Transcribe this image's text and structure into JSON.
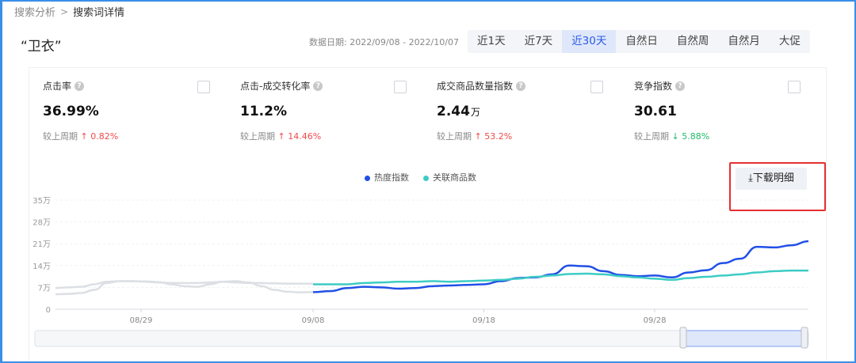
{
  "breadcrumb": {
    "parent": "搜索分析",
    "separator": ">",
    "current": "搜索词详情"
  },
  "title": "“卫衣”",
  "date_range": "数据日期: 2022/09/08 - 2022/10/07",
  "tabs": [
    {
      "label": "近1天",
      "active": false
    },
    {
      "label": "近7天",
      "active": false
    },
    {
      "label": "近30天",
      "active": true
    },
    {
      "label": "自然日",
      "active": false
    },
    {
      "label": "自然周",
      "active": false
    },
    {
      "label": "自然月",
      "active": false
    },
    {
      "label": "大促",
      "active": false
    }
  ],
  "metrics": [
    {
      "label": "点击率",
      "value": "36.99%",
      "unit": "",
      "compare_prefix": "较上周期",
      "change": "0.82%",
      "direction": "up"
    },
    {
      "label": "点击-成交转化率",
      "value": "11.2%",
      "unit": "",
      "compare_prefix": "较上周期",
      "change": "14.46%",
      "direction": "up"
    },
    {
      "label": "成交商品数量指数",
      "value": "2.44",
      "unit": "万",
      "compare_prefix": "较上周期",
      "change": "53.2%",
      "direction": "up"
    },
    {
      "label": "竞争指数",
      "value": "30.61",
      "unit": "",
      "compare_prefix": "较上周期",
      "change": "5.88%",
      "direction": "down"
    }
  ],
  "download_button": "下载明细",
  "icons": {
    "help": "help-circle-icon",
    "download": "download-icon",
    "arrow_up": "arrow-up-icon",
    "arrow_down": "arrow-down-icon"
  },
  "colors": {
    "series_heat": "#2150e6",
    "series_goods": "#3dccc4",
    "previous_period": "#dcdfe4",
    "up": "#f04a4a",
    "down": "#1fba6a",
    "highlight_box": "#e53030"
  },
  "chart_data": {
    "type": "line",
    "xlabel": "",
    "ylabel": "",
    "y_tick_labels": [
      "0",
      "7万",
      "14万",
      "21万",
      "28万",
      "35万"
    ],
    "y_tick_values": [
      0,
      70000,
      140000,
      210000,
      280000,
      350000
    ],
    "ylim": [
      0,
      350000
    ],
    "x_tick_labels": [
      "08/29",
      "09/08",
      "09/18",
      "09/28"
    ],
    "legend_position": "top-center",
    "grid": true,
    "x_current": [
      "09/08",
      "09/09",
      "09/10",
      "09/11",
      "09/12",
      "09/13",
      "09/14",
      "09/15",
      "09/16",
      "09/17",
      "09/18",
      "09/19",
      "09/20",
      "09/21",
      "09/22",
      "09/23",
      "09/24",
      "09/25",
      "09/26",
      "09/27",
      "09/28",
      "09/29",
      "09/30",
      "10/01",
      "10/02",
      "10/03",
      "10/04",
      "10/05",
      "10/06",
      "10/07"
    ],
    "series": [
      {
        "name": "热度指数",
        "values": [
          55000,
          58000,
          68000,
          72000,
          70000,
          66000,
          68000,
          74000,
          76000,
          78000,
          80000,
          90000,
          100000,
          102000,
          112000,
          140000,
          138000,
          122000,
          110000,
          106000,
          108000,
          102000,
          118000,
          125000,
          148000,
          162000,
          200000,
          198000,
          205000,
          218000
        ]
      },
      {
        "name": "关联商品数",
        "values": [
          80000,
          80000,
          80000,
          84000,
          86000,
          88000,
          88000,
          90000,
          88000,
          90000,
          92000,
          94000,
          98000,
          104000,
          108000,
          113000,
          114000,
          112000,
          106000,
          102000,
          98000,
          94000,
          100000,
          104000,
          108000,
          112000,
          118000,
          122000,
          124000,
          124000
        ]
      }
    ],
    "previous_period": {
      "x": [
        "08/08",
        "08/09",
        "08/10",
        "08/11",
        "08/12",
        "08/13",
        "08/14",
        "08/15",
        "08/16",
        "08/17",
        "08/18",
        "08/19",
        "08/20",
        "08/21",
        "08/22",
        "08/23",
        "08/24",
        "08/25",
        "08/26",
        "08/27",
        "08/28",
        "08/29",
        "08/30",
        "08/31",
        "09/01",
        "09/02",
        "09/03",
        "09/04",
        "09/05",
        "09/06",
        "09/07"
      ],
      "series": [
        {
          "name": "热度指数",
          "values": [
            48000,
            49000,
            52000,
            62000,
            84000,
            90000,
            90000,
            89000,
            87000,
            80000,
            74000,
            72000,
            80000,
            88000,
            90000,
            86000,
            74000,
            62000,
            56000,
            54000,
            55000
          ]
        },
        {
          "name": "关联商品数",
          "values": [
            68000,
            70000,
            72000,
            80000,
            88000,
            90000,
            90000,
            88000,
            86000,
            84000,
            84000,
            84000,
            86000,
            88000,
            86000,
            84000,
            84000,
            83000,
            82000,
            82000,
            82000
          ]
        }
      ]
    }
  }
}
